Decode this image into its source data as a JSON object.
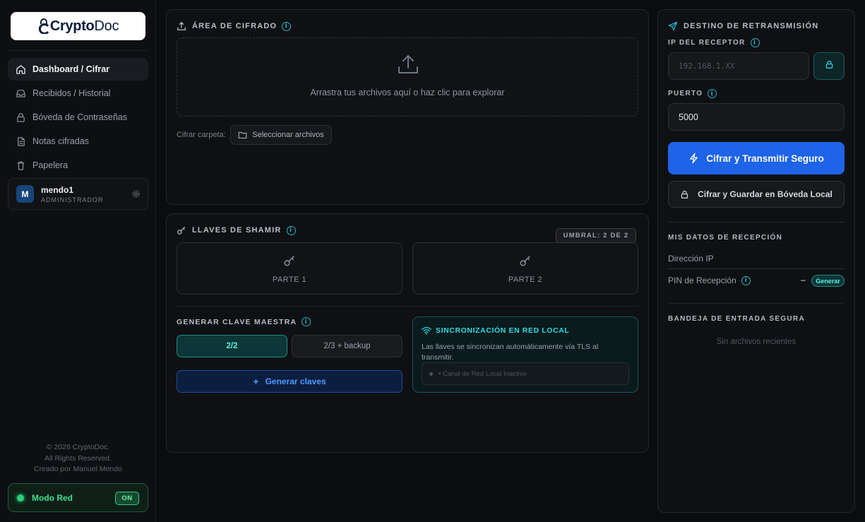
{
  "brand": {
    "logo_bold": "Crypto",
    "logo_light": "Doc"
  },
  "sidebar": {
    "items": [
      {
        "label": "Dashboard / Cifrar",
        "icon": "home-icon",
        "active": true
      },
      {
        "label": "Recibidos / Historial",
        "icon": "inbox-icon"
      },
      {
        "label": "Bóveda de Contraseñas",
        "icon": "lock-icon"
      },
      {
        "label": "Notas cifradas",
        "icon": "document-icon"
      },
      {
        "label": "Papelera",
        "icon": "trash-icon"
      }
    ],
    "user": {
      "initial": "M",
      "name": "mendo1",
      "role": "ADMINISTRADOR"
    },
    "footer": {
      "line1": "© 2026 CryptoDoc.",
      "line2": "All Rights Reserved.",
      "line3": "Creado por Manuel Mendo"
    },
    "network": {
      "label": "Modo Red",
      "state": "ON"
    }
  },
  "encrypt_area": {
    "title": "ÁREA DE CIFRADO",
    "drop_text": "Arrastra tus archivos aquí o haz clic para explorar",
    "folder_label": "Cifrar carpeta:",
    "select_button": "Seleccionar archivos"
  },
  "shamir": {
    "title": "LLAVES DE SHAMIR",
    "threshold": "UMBRAL: 2 DE 2",
    "parts": [
      "PARTE 1",
      "PARTE 2"
    ],
    "master_title": "GENERAR CLAVE MAESTRA",
    "options": [
      "2/2",
      "2/3 + backup"
    ],
    "selected_option": "2/2",
    "generate_button": "Generar claves",
    "sync": {
      "title": "SINCRONIZACIÓN EN RED LOCAL",
      "description": "Las llaves se sincronizan automáticamente vía TLS al transmitir.",
      "status": "• Canal de Red Local Inactivo"
    }
  },
  "transmit": {
    "title": "DESTINO DE RETRANSMISIÓN",
    "ip_label": "IP DEL RECEPTOR",
    "ip_placeholder": "192.168.1.XX",
    "port_label": "PUERTO",
    "port_value": "5000",
    "primary_button": "Cifrar y Transmitir Seguro",
    "secondary_button": "Cifrar y Guardar en Bóveda Local",
    "reception_title": "MIS DATOS DE RECEPCIÓN",
    "ip_address_label": "Dirección IP",
    "pin_label": "PIN de Recepción",
    "pin_value": "–",
    "pin_generate": "Generar",
    "inbox_title": "BANDEJA DE ENTRADA SEGURA",
    "inbox_empty": "Sin archivos recientes"
  },
  "colors": {
    "accent": "#1e63e8",
    "teal": "#22b7c8",
    "green": "#2ad07a"
  }
}
